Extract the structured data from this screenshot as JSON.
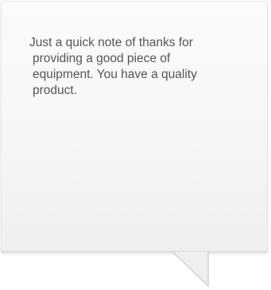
{
  "testimonial": {
    "lines": [
      "Just a quick note of thanks for",
      "providing a good piece of",
      "equipment. You have a quality",
      "product."
    ]
  },
  "colors": {
    "text": "#555555",
    "bubble_top": "#fbfbfb",
    "bubble_bottom": "#efefef",
    "border": "#e6e6e6"
  }
}
